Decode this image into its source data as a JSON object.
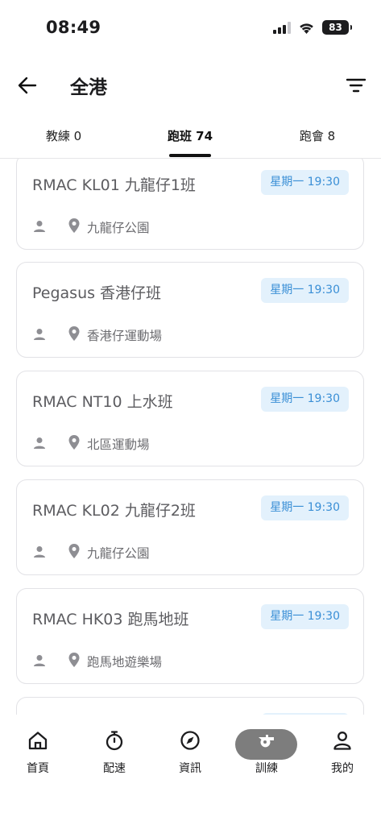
{
  "status_bar": {
    "time": "08:49",
    "battery": "83"
  },
  "header": {
    "title": "全港"
  },
  "tabs": [
    {
      "label": "教練 0"
    },
    {
      "label": "跑班 74"
    },
    {
      "label": "跑會 8"
    }
  ],
  "cards": [
    {
      "title": "RMAC KL01 九龍仔1班",
      "schedule": "星期一 19:30",
      "location": "九龍仔公園"
    },
    {
      "title": "Pegasus 香港仔班",
      "schedule": "星期一 19:30",
      "location": "香港仔運動場"
    },
    {
      "title": "RMAC NT10 上水班",
      "schedule": "星期一 19:30",
      "location": "北區運動場"
    },
    {
      "title": "RMAC KL02 九龍仔2班",
      "schedule": "星期一 19:30",
      "location": "九龍仔公園"
    },
    {
      "title": "RMAC HK03 跑馬地班",
      "schedule": "星期一 19:30",
      "location": "跑馬地遊樂場"
    },
    {
      "title": "",
      "schedule": "",
      "location": ""
    }
  ],
  "nav": [
    {
      "label": "首頁",
      "icon": "home-icon"
    },
    {
      "label": "配速",
      "icon": "stopwatch-icon"
    },
    {
      "label": "資訊",
      "icon": "compass-icon"
    },
    {
      "label": "訓練",
      "icon": "whistle-icon"
    },
    {
      "label": "我的",
      "icon": "profile-icon"
    }
  ],
  "colors": {
    "badge_bg": "#e3f1fc",
    "badge_text": "#3a8fd6",
    "active_nav_pill": "#7d7d7d"
  }
}
